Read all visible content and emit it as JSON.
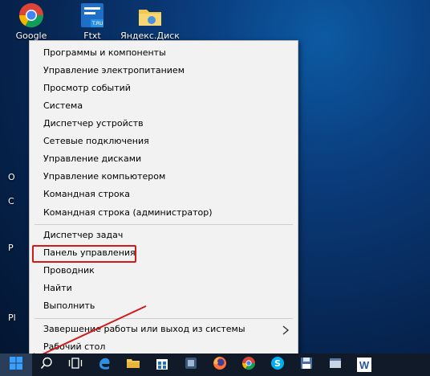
{
  "desktop": {
    "icons": [
      {
        "label": "Google",
        "icon": "chrome-icon"
      },
      {
        "label": "Ftxt",
        "icon": "ftxt-app-icon",
        "badge": "T.RU"
      },
      {
        "label": "Яндекс.Диск",
        "icon": "yandex-disk-icon"
      }
    ],
    "edge_letters": [
      "O",
      "C",
      "P",
      "Pl"
    ]
  },
  "context_menu": {
    "items": [
      {
        "label": "Программы и компоненты"
      },
      {
        "label": "Управление электропитанием"
      },
      {
        "label": "Просмотр событий"
      },
      {
        "label": "Система"
      },
      {
        "label": "Диспетчер устройств"
      },
      {
        "label": "Сетевые подключения"
      },
      {
        "label": "Управление дисками"
      },
      {
        "label": "Управление компьютером"
      },
      {
        "label": "Командная строка"
      },
      {
        "label": "Командная строка (администратор)"
      },
      {
        "label": "Диспетчер задач"
      },
      {
        "label": "Панель управления"
      },
      {
        "label": "Проводник"
      },
      {
        "label": "Найти"
      },
      {
        "label": "Выполнить"
      },
      {
        "label": "Завершение работы или выход из системы"
      },
      {
        "label": "Рабочий стол"
      }
    ],
    "highlighted_item": "Панель управления",
    "submenu_icon": "chevron-right-icon"
  },
  "annotation": {
    "color": "#d11a1a"
  },
  "taskbar": {
    "items": [
      {
        "name": "start-button",
        "icon": "windows-logo-icon"
      },
      {
        "name": "search-button",
        "icon": "search-icon"
      },
      {
        "name": "task-view-button",
        "icon": "task-view-icon"
      },
      {
        "name": "edge-button",
        "icon": "edge-icon"
      },
      {
        "name": "explorer-button",
        "icon": "folder-icon"
      },
      {
        "name": "store-button",
        "icon": "store-icon"
      },
      {
        "name": "app-button",
        "icon": "app-icon"
      },
      {
        "name": "firefox-button",
        "icon": "firefox-icon"
      },
      {
        "name": "chrome-button",
        "icon": "chrome-icon"
      },
      {
        "name": "skype-button",
        "icon": "skype-icon"
      },
      {
        "name": "save-app-button",
        "icon": "floppy-icon"
      },
      {
        "name": "app2-button",
        "icon": "app-icon"
      },
      {
        "name": "word-button",
        "icon": "word-icon",
        "text": "W"
      }
    ]
  }
}
